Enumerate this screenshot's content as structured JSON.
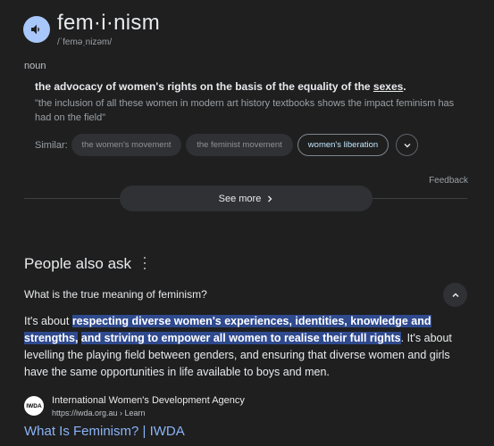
{
  "dictionary": {
    "word": "fem·i·nism",
    "phonetic": "/ˈfeməˌnizəm/",
    "part_of_speech": "noun",
    "definition_main": "the advocacy of women's rights on the basis of the equality of the ",
    "definition_link": "sexes",
    "definition_end": ".",
    "example": "\"the inclusion of all these women in modern art history textbooks shows the impact feminism has had on the field\"",
    "similar_label": "Similar:",
    "similar": [
      "the women's movement",
      "the feminist movement",
      "women's liberation"
    ],
    "feedback": "Feedback",
    "see_more": "See more"
  },
  "people_also_ask": {
    "title": "People also ask",
    "question": "What is the true meaning of feminism?",
    "answer_prefix": "It's about ",
    "answer_highlight_1": "respecting diverse women's experiences, identities, knowledge and strengths,",
    "answer_highlight_2": "and striving to empower all women to realise their full rights",
    "answer_suffix": ". It's about levelling the playing field between genders, and ensuring that diverse women and girls have the same opportunities in life available to boys and men.",
    "source": {
      "favicon_text": "IWDA",
      "name": "International Women's Development Agency",
      "url": "https://iwda.org.au › Learn",
      "link_title": "What Is Feminism? | IWDA"
    }
  },
  "colors": {
    "background": "#1f1f1f",
    "accent": "#a8c7fa",
    "link": "#8ab4f8",
    "highlight": "#2f4a8f"
  }
}
